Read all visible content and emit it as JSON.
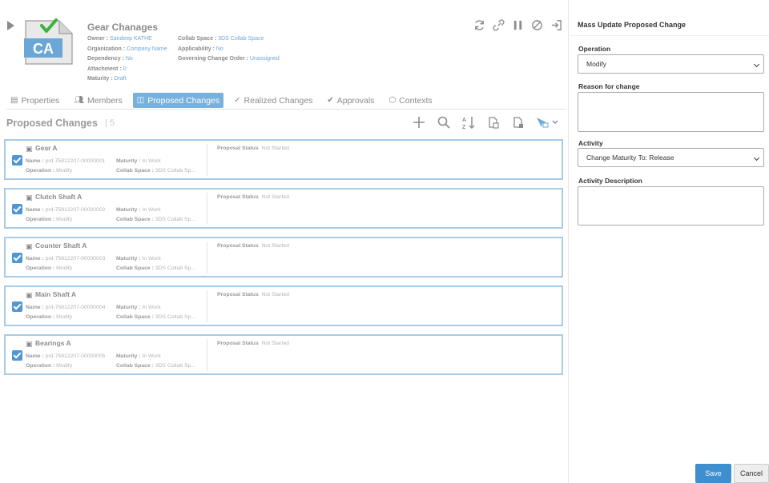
{
  "header": {
    "title": "Gear Chanages",
    "icon_letters": "CA",
    "attributes": [
      {
        "label": "Owner",
        "value": "Sandeep KATHE"
      },
      {
        "label": "Organization",
        "value": "Company Name"
      },
      {
        "label": "Dependency",
        "value": "No"
      },
      {
        "label": "Attachment",
        "value": "0"
      },
      {
        "label": "Maturity",
        "value": "Draft"
      },
      {
        "label": "Collab Space",
        "value": "3DS Collab Space"
      },
      {
        "label": "Applicability",
        "value": "No"
      },
      {
        "label": "Governing Change Order",
        "value": "Unassigned"
      }
    ],
    "action_icons": [
      "refresh-icon",
      "link-icon",
      "pause-icon",
      "cancel-icon",
      "exit-icon"
    ]
  },
  "tabs": [
    {
      "label": "Properties",
      "icon": "properties-icon"
    },
    {
      "label": "Members",
      "icon": "members-icon"
    },
    {
      "label": "Proposed Changes",
      "icon": "proposed-changes-icon",
      "active": true
    },
    {
      "label": "Realized Changes",
      "icon": "realized-changes-icon"
    },
    {
      "label": "Approvals",
      "icon": "approvals-icon"
    },
    {
      "label": "Contexts",
      "icon": "contexts-icon"
    }
  ],
  "section": {
    "title": "Proposed Changes",
    "count": "5"
  },
  "labels": {
    "name": "Name :",
    "maturity": "Maturity :",
    "operation": "Operation :",
    "collab_space": "Collab Space :",
    "proposal_status": "Proposal Status"
  },
  "items": [
    {
      "title": "Gear A",
      "name": "prd-75812207-00000001",
      "maturity": "In Work",
      "operation": "Modify",
      "collab_space": "3DS Collab Sp...",
      "proposal_status": "Not Started",
      "checked": true
    },
    {
      "title": "Clutch Shaft A",
      "name": "prd-75812207-00000002",
      "maturity": "In Work",
      "operation": "Modify",
      "collab_space": "3DS Collab Sp...",
      "proposal_status": "Not Started",
      "checked": true
    },
    {
      "title": "Counter Shaft A",
      "name": "prd-75812207-00000003",
      "maturity": "In Work",
      "operation": "Modify",
      "collab_space": "3DS Collab Sp...",
      "proposal_status": "Not Started",
      "checked": true
    },
    {
      "title": "Main Shaft A",
      "name": "prd-75812207-00000004",
      "maturity": "In Work",
      "operation": "Modify",
      "collab_space": "3DS Collab Sp...",
      "proposal_status": "Not Started",
      "checked": true
    },
    {
      "title": "Bearings A",
      "name": "prd-75812207-00000005",
      "maturity": "In Work",
      "operation": "Modify",
      "collab_space": "3DS Collab Sp...",
      "proposal_status": "Not Started",
      "checked": true
    }
  ],
  "panel": {
    "title": "Mass Update Proposed Change",
    "operation_label": "Operation",
    "operation_value": "Modify",
    "reason_label": "Reason for change",
    "reason_value": "",
    "activity_label": "Activity",
    "activity_value": "Change Maturity To: Release",
    "activity_description_label": "Activity Description",
    "activity_description_value": "",
    "save_label": "Save",
    "cancel_label": "Cancel"
  },
  "colors": {
    "accent": "#3d8fd0",
    "active_tab": "#78b1dc",
    "card_border": "#a8cbe7",
    "link": "#6fa8d6"
  }
}
